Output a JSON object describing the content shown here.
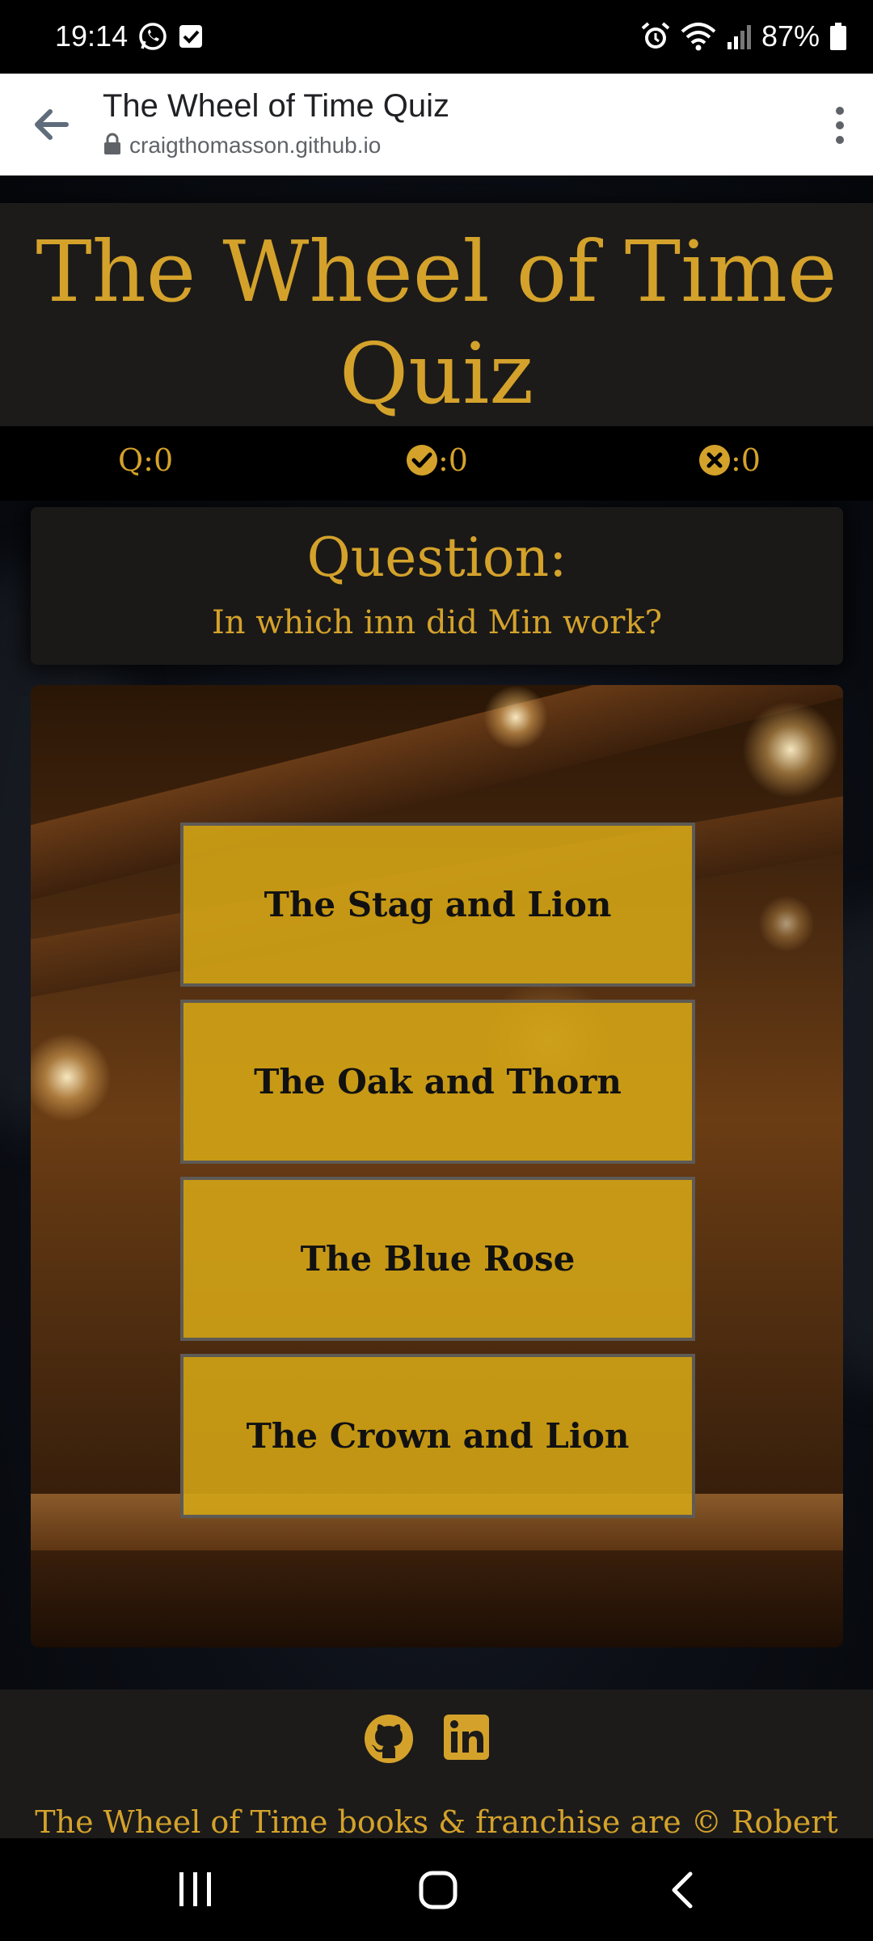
{
  "status_bar": {
    "time": "19:14",
    "battery": "87%",
    "icons": [
      "whatsapp-icon",
      "checkbox-notification-icon",
      "alarm-icon",
      "wifi-icon",
      "signal-icon",
      "battery-icon"
    ]
  },
  "browser": {
    "title": "The Wheel of Time Quiz",
    "url": "craigthomasson.github.io",
    "icons": [
      "back-arrow-icon",
      "lock-icon",
      "more-vert-icon"
    ]
  },
  "header": {
    "title_line1": "The Wheel of Time",
    "title_line2": "Quiz"
  },
  "scores": {
    "questions": "Q:0",
    "correct": ":0",
    "incorrect": ":0"
  },
  "question": {
    "label": "Question:",
    "text": "In which inn did Min work?"
  },
  "answers": [
    {
      "label": "The Stag and Lion"
    },
    {
      "label": "The Oak and Thorn"
    },
    {
      "label": "The Blue Rose"
    },
    {
      "label": "The Crown and Lion"
    }
  ],
  "footer": {
    "icons": [
      "github-icon",
      "linkedin-icon"
    ],
    "note": "The Wheel of Time books & franchise are © Robert"
  },
  "nav_bar": {
    "icons": [
      "recent-apps-icon",
      "home-icon",
      "back-icon"
    ]
  },
  "colors": {
    "accent": "#d4a22b",
    "answer_button": "#d5a616",
    "panel_bg": "#1c1b1a"
  }
}
